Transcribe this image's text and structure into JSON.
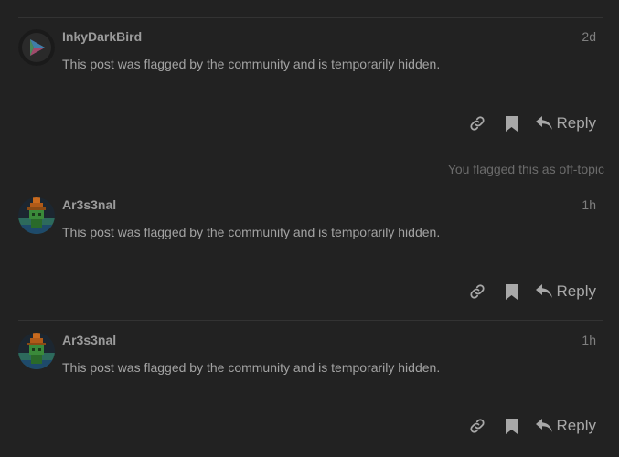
{
  "posts": [
    {
      "username": "InkyDarkBird",
      "date": "2d",
      "body": "This post was flagged by the community and is temporarily hidden.",
      "avatar_icon": "play-arrow-avatar-icon",
      "actions": {
        "link_icon": "link-icon",
        "bookmark_icon": "bookmark-icon",
        "reply_label": "Reply"
      },
      "footer_note": "You flagged this as off-topic"
    },
    {
      "username": "Ar3s3nal",
      "date": "1h",
      "body": "This post was flagged by the community and is temporarily hidden.",
      "avatar_icon": "pixel-character-avatar-icon",
      "actions": {
        "link_icon": "link-icon",
        "bookmark_icon": "bookmark-icon",
        "reply_label": "Reply"
      }
    },
    {
      "username": "Ar3s3nal",
      "date": "1h",
      "body": "This post was flagged by the community and is temporarily hidden.",
      "avatar_icon": "pixel-character-avatar-icon",
      "actions": {
        "link_icon": "link-icon",
        "bookmark_icon": "bookmark-icon",
        "reply_label": "Reply"
      }
    }
  ],
  "colors": {
    "background": "#222222",
    "text": "#a3a3a3",
    "muted": "#6b6b6b",
    "divider": "#333333"
  }
}
